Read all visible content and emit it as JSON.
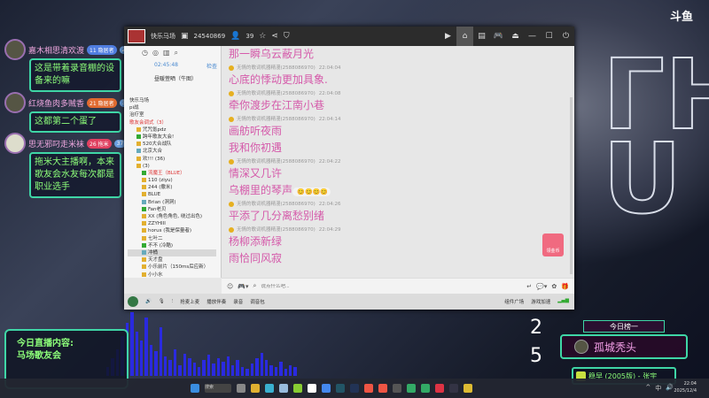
{
  "brand": "斗鱼",
  "overlay_chat": [
    {
      "user": "嘉木相思清欢渡",
      "badge": "11 隐居者",
      "level": "25",
      "text": "这是带着录音棚的设备来的嘛"
    },
    {
      "user": "红烧鱼肉多贼香",
      "badge": "21 隐居者",
      "level": "32",
      "text": "这都第二个蛋了"
    },
    {
      "user": "思无邪叼走米袜",
      "badge": "26 拖米",
      "level": "37",
      "text": "拖米大主播啊，本来歌友会水友每次都是职业选手"
    }
  ],
  "window": {
    "room_name": "快乐马场",
    "room_id": "24540869",
    "users": "39",
    "left": {
      "time": "02:45:48",
      "check": "检查",
      "current": "昼暖萱晒（牛图）",
      "tree": [
        "快乐马场",
        "pi战",
        "治疗室",
        "歌友会调式（3）",
        "咒咒氪pdz",
        "跨年歌友大会!",
        "520大合战队",
        "北京大合",
        "欢!!! (36)",
        "(3)",
        "流魔王（BLUE）",
        "110 (ziyu)",
        "244 (撒米)",
        "BLUE",
        "Brian (洞洞)",
        "Fan老贝",
        "XX (角色角色, 绕过出色)",
        "ZZYHIII",
        "horus (我是保量者)",
        "七叶二",
        "不不 (冷酷)",
        "冲桶",
        "天才盘",
        "小乐前片（150ms后应新）",
        "小小水"
      ]
    },
    "messages": [
      {
        "lines": [
          "那一瞬乌云蔽月光"
        ]
      },
      {
        "meta": "无情的歌词机器精漫(2588086970)",
        "time": "22:04:04",
        "lines": [
          "心底的悸动更加具象."
        ]
      },
      {
        "meta": "无情的歌词机器精漫(2588086970)",
        "time": "22:04:08",
        "lines": [
          "牵你渡步在江南小巷"
        ]
      },
      {
        "meta": "无情的歌词机器精漫(2588086970)",
        "time": "22:04:14",
        "lines": [
          "画舫听夜雨",
          "我和你初遇"
        ]
      },
      {
        "meta": "无情的歌词机器精漫(2588086970)",
        "time": "22:04:22",
        "lines": [
          "情深又几许",
          "乌棚里的琴声"
        ]
      },
      {
        "meta": "无情的歌词机器精漫(2588086970)",
        "time": "22:04:26",
        "lines": [
          "平添了几分离愁别绪"
        ]
      },
      {
        "meta": "无情的歌词机器精漫(2588086970)",
        "time": "22:04:29",
        "lines": [
          "杨柳添新绿",
          "雨恰同风寂"
        ]
      }
    ],
    "coin_label": "领金币",
    "input_placeholder": "说点什么吧...",
    "status": {
      "mic_label": "抢麦上麦",
      "accompany": "播放伴奏",
      "record": "录音",
      "sound": "调音包",
      "plaza": "组件广场",
      "game": "游戏加速"
    }
  },
  "overlay": {
    "today_content": "今日直播内容:",
    "content": "马场歌友会",
    "digits": [
      "2",
      "5"
    ],
    "rank_title": "今日榜一",
    "rank_user": "孤城秃头",
    "song": "稳早 (2005版) - 张宇"
  },
  "taskbar": {
    "search": "搜索",
    "time": "22:04",
    "date": "2025/12/4",
    "ime": "中"
  }
}
